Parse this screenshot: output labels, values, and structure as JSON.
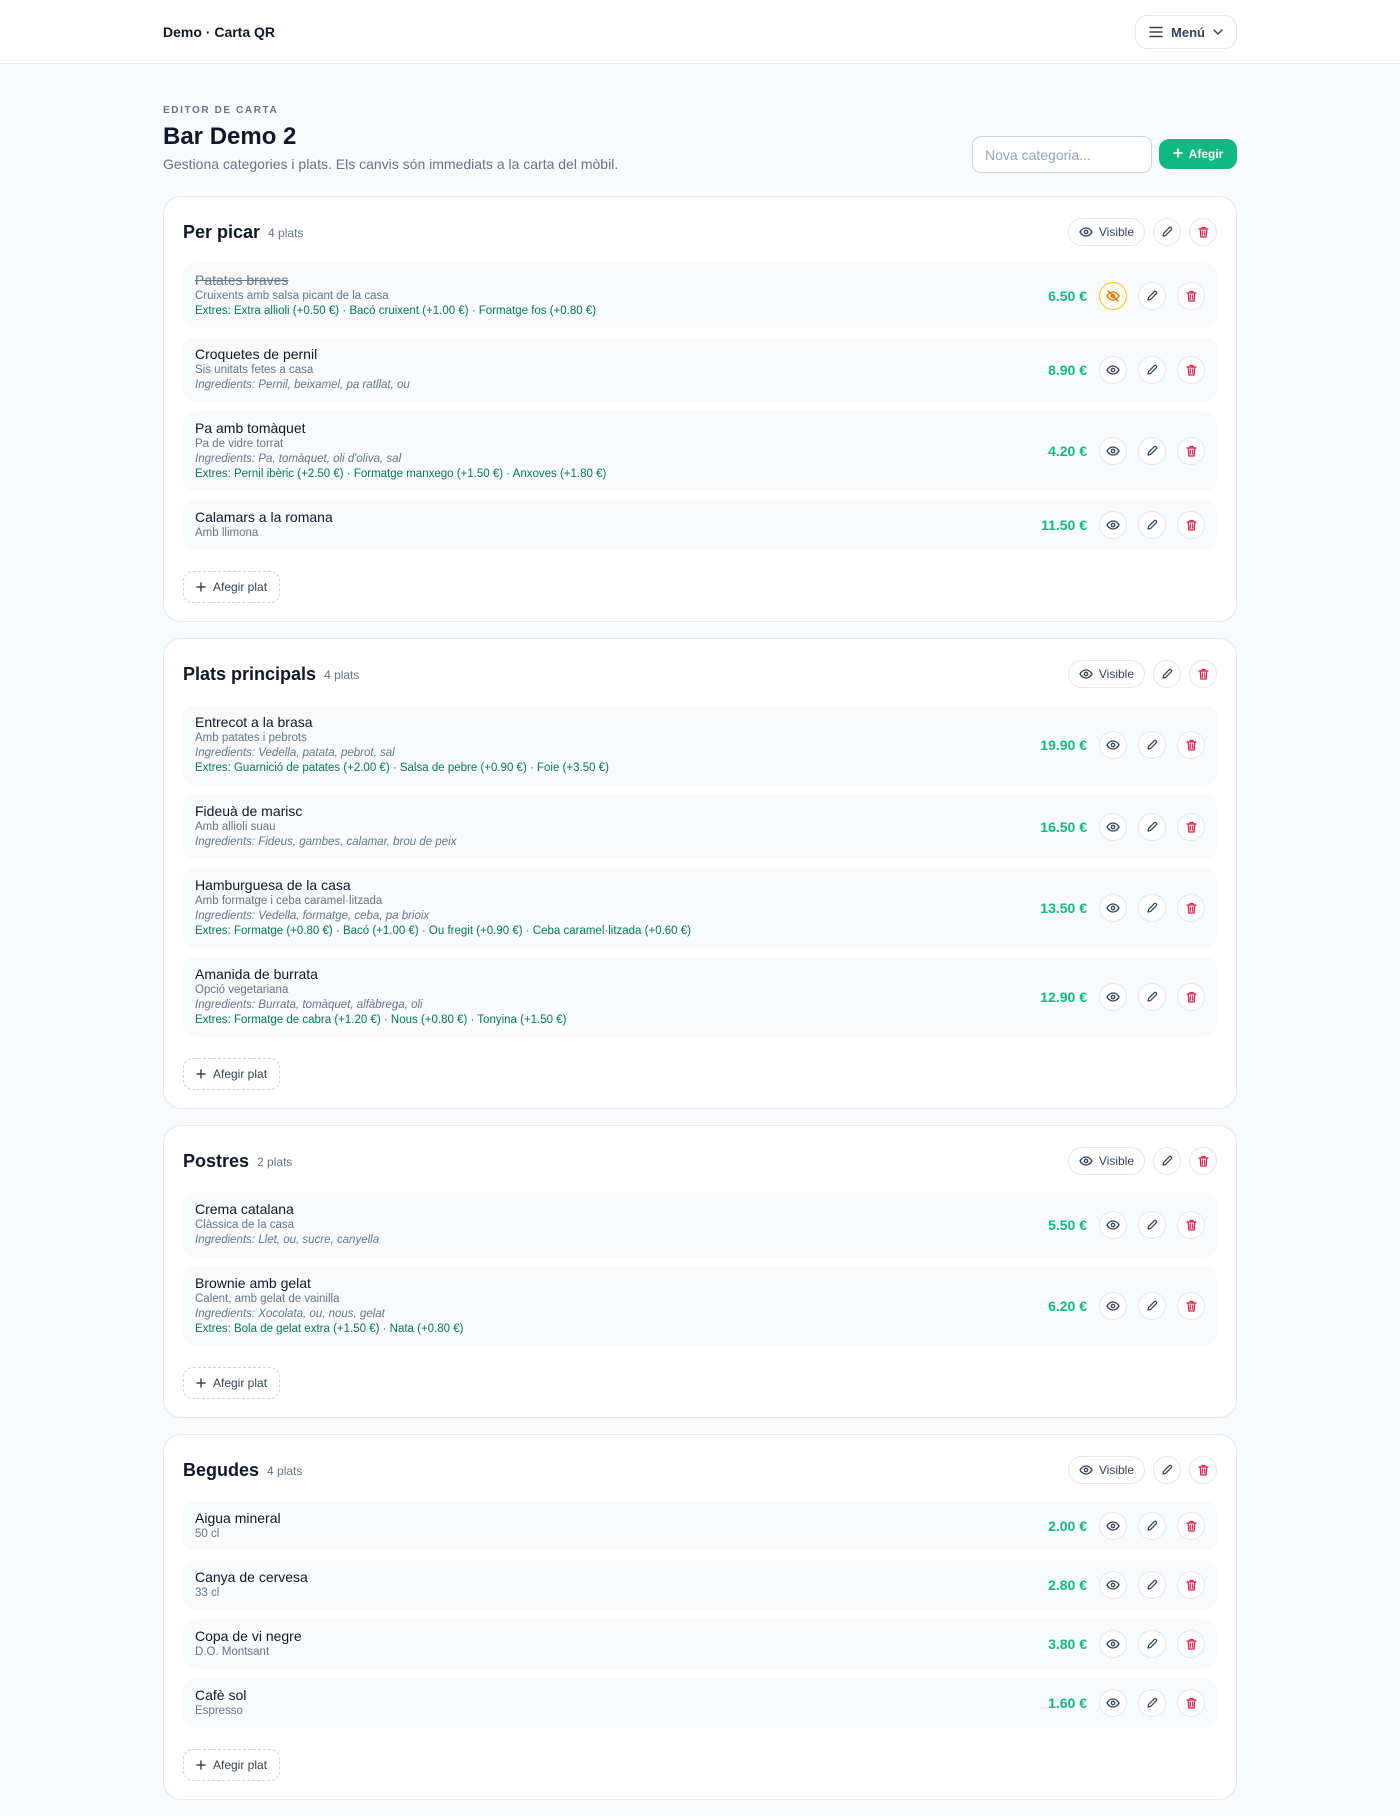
{
  "topbar": {
    "brand": "Demo · Carta QR",
    "menu_label": "Menú"
  },
  "page": {
    "eyebrow": "EDITOR DE CARTA",
    "title": "Bar Demo 2",
    "subtitle": "Gestiona categories i plats. Els canvis són immediats a la carta del mòbil.",
    "new_category_placeholder": "Nova categoria...",
    "add_button": "Afegir"
  },
  "labels": {
    "visible": "Visible",
    "add_dish": "Afegir plat"
  },
  "colors": {
    "accent": "#10b981",
    "extras": "#047857",
    "danger": "#e11d48",
    "hidden_highlight": "#f59e0b"
  },
  "categories": [
    {
      "name": "Per picar",
      "count": "4 plats",
      "dishes": [
        {
          "name": "Patates braves",
          "hidden": true,
          "desc": "Cruixents amb salsa picant de la casa",
          "ingredients": "",
          "extras": "Extres: Extra allioli (+0.50 €) · Bacó cruixent (+1.00 €) · Formatge fos (+0.80 €)",
          "price": "6.50 €"
        },
        {
          "name": "Croquetes de pernil",
          "hidden": false,
          "desc": "Sis unitats fetes a casa",
          "ingredients": "Ingredients: Pernil, beixamel, pa ratllat, ou",
          "extras": "",
          "price": "8.90 €"
        },
        {
          "name": "Pa amb tomàquet",
          "hidden": false,
          "desc": "Pa de vidre torrat",
          "ingredients": "Ingredients: Pa, tomàquet, oli d'oliva, sal",
          "extras": "Extres: Pernil ibèric (+2.50 €) · Formatge manxego (+1.50 €) · Anxoves (+1.80 €)",
          "price": "4.20 €"
        },
        {
          "name": "Calamars a la romana",
          "hidden": false,
          "desc": "Amb llimona",
          "ingredients": "",
          "extras": "",
          "price": "11.50 €"
        }
      ]
    },
    {
      "name": "Plats principals",
      "count": "4 plats",
      "dishes": [
        {
          "name": "Entrecot a la brasa",
          "hidden": false,
          "desc": "Amb patates i pebrots",
          "ingredients": "Ingredients: Vedella, patata, pebrot, sal",
          "extras": "Extres: Guarnició de patates (+2.00 €) · Salsa de pebre (+0.90 €) · Foie (+3.50 €)",
          "price": "19.90 €"
        },
        {
          "name": "Fideuà de marisc",
          "hidden": false,
          "desc": "Amb allioli suau",
          "ingredients": "Ingredients: Fideus, gambes, calamar, brou de peix",
          "extras": "",
          "price": "16.50 €"
        },
        {
          "name": "Hamburguesa de la casa",
          "hidden": false,
          "desc": "Amb formatge i ceba caramel·litzada",
          "ingredients": "Ingredients: Vedella, formatge, ceba, pa brioix",
          "extras": "Extres: Formatge (+0.80 €) · Bacó (+1.00 €) · Ou fregit (+0.90 €) · Ceba caramel·litzada (+0.60 €)",
          "price": "13.50 €"
        },
        {
          "name": "Amanida de burrata",
          "hidden": false,
          "desc": "Opció vegetariana",
          "ingredients": "Ingredients: Burrata, tomàquet, alfàbrega, oli",
          "extras": "Extres: Formatge de cabra (+1.20 €) · Nous (+0.80 €) · Tonyina (+1.50 €)",
          "price": "12.90 €"
        }
      ]
    },
    {
      "name": "Postres",
      "count": "2 plats",
      "dishes": [
        {
          "name": "Crema catalana",
          "hidden": false,
          "desc": "Clàssica de la casa",
          "ingredients": "Ingredients: Llet, ou, sucre, canyella",
          "extras": "",
          "price": "5.50 €"
        },
        {
          "name": "Brownie amb gelat",
          "hidden": false,
          "desc": "Calent, amb gelat de vainilla",
          "ingredients": "Ingredients: Xocolata, ou, nous, gelat",
          "extras": "Extres: Bola de gelat extra (+1.50 €) · Nata (+0.80 €)",
          "price": "6.20 €"
        }
      ]
    },
    {
      "name": "Begudes",
      "count": "4 plats",
      "dishes": [
        {
          "name": "Aigua mineral",
          "hidden": false,
          "desc": "50 cl",
          "ingredients": "",
          "extras": "",
          "price": "2.00 €"
        },
        {
          "name": "Canya de cervesa",
          "hidden": false,
          "desc": "33 cl",
          "ingredients": "",
          "extras": "",
          "price": "2.80 €"
        },
        {
          "name": "Copa de vi negre",
          "hidden": false,
          "desc": "D.O. Montsant",
          "ingredients": "",
          "extras": "",
          "price": "3.80 €"
        },
        {
          "name": "Cafè sol",
          "hidden": false,
          "desc": "Espresso",
          "ingredients": "",
          "extras": "",
          "price": "1.60 €"
        }
      ]
    }
  ]
}
